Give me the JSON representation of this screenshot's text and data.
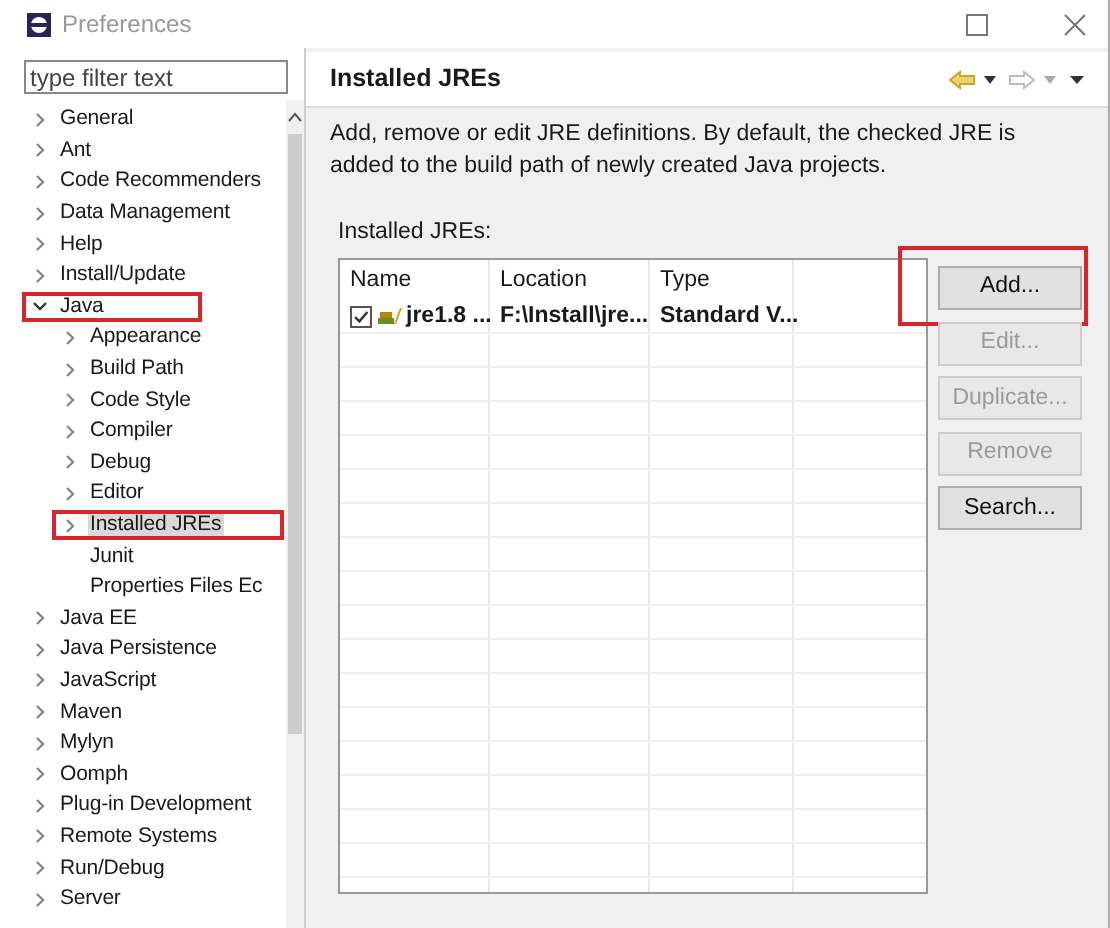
{
  "window": {
    "title": "Preferences"
  },
  "filter": {
    "placeholder": "type filter text"
  },
  "tree": [
    {
      "label": "General",
      "kind": "folder",
      "expanded": false,
      "selected": false,
      "highlighted": false
    },
    {
      "label": "Ant",
      "kind": "folder",
      "expanded": false,
      "selected": false,
      "highlighted": false
    },
    {
      "label": "Code Recommenders",
      "kind": "folder",
      "expanded": false,
      "selected": false,
      "highlighted": false
    },
    {
      "label": "Data Management",
      "kind": "folder",
      "expanded": false,
      "selected": false,
      "highlighted": false
    },
    {
      "label": "Help",
      "kind": "folder",
      "expanded": false,
      "selected": false,
      "highlighted": false
    },
    {
      "label": "Install/Update",
      "kind": "folder",
      "expanded": false,
      "selected": false,
      "highlighted": false
    },
    {
      "label": "Java",
      "kind": "folder",
      "expanded": true,
      "selected": false,
      "highlighted": true,
      "children": [
        {
          "label": "Appearance",
          "kind": "folder",
          "expanded": false,
          "selected": false,
          "highlighted": false
        },
        {
          "label": "Build Path",
          "kind": "folder",
          "expanded": false,
          "selected": false,
          "highlighted": false
        },
        {
          "label": "Code Style",
          "kind": "folder",
          "expanded": false,
          "selected": false,
          "highlighted": false
        },
        {
          "label": "Compiler",
          "kind": "folder",
          "expanded": false,
          "selected": false,
          "highlighted": false
        },
        {
          "label": "Debug",
          "kind": "folder",
          "expanded": false,
          "selected": false,
          "highlighted": false
        },
        {
          "label": "Editor",
          "kind": "folder",
          "expanded": false,
          "selected": false,
          "highlighted": false
        },
        {
          "label": "Installed JREs",
          "kind": "folder",
          "expanded": false,
          "selected": true,
          "highlighted": true
        },
        {
          "label": "Junit",
          "kind": "leaf",
          "selected": false,
          "highlighted": false
        },
        {
          "label": "Properties Files Ec",
          "kind": "leaf",
          "selected": false,
          "highlighted": false
        }
      ]
    },
    {
      "label": "Java EE",
      "kind": "folder",
      "expanded": false,
      "selected": false,
      "highlighted": false
    },
    {
      "label": "Java Persistence",
      "kind": "folder",
      "expanded": false,
      "selected": false,
      "highlighted": false
    },
    {
      "label": "JavaScript",
      "kind": "folder",
      "expanded": false,
      "selected": false,
      "highlighted": false
    },
    {
      "label": "Maven",
      "kind": "folder",
      "expanded": false,
      "selected": false,
      "highlighted": false
    },
    {
      "label": "Mylyn",
      "kind": "folder",
      "expanded": false,
      "selected": false,
      "highlighted": false
    },
    {
      "label": "Oomph",
      "kind": "folder",
      "expanded": false,
      "selected": false,
      "highlighted": false
    },
    {
      "label": "Plug-in Development",
      "kind": "folder",
      "expanded": false,
      "selected": false,
      "highlighted": false
    },
    {
      "label": "Remote Systems",
      "kind": "folder",
      "expanded": false,
      "selected": false,
      "highlighted": false
    },
    {
      "label": "Run/Debug",
      "kind": "folder",
      "expanded": false,
      "selected": false,
      "highlighted": false
    },
    {
      "label": "Server",
      "kind": "folder",
      "expanded": false,
      "selected": false,
      "highlighted": false
    }
  ],
  "page": {
    "title": "Installed JREs",
    "description": "Add, remove or edit JRE definitions. By default, the checked JRE is added to the build path of newly created Java projects.",
    "table_label": "Installed JREs:",
    "table": {
      "columns": [
        "Name",
        "Location",
        "Type"
      ],
      "rows": [
        {
          "checked": true,
          "name": "jre1.8 ...",
          "location": "F:\\Install\\jre...",
          "type": "Standard V..."
        }
      ]
    },
    "buttons": [
      {
        "label": "Add...",
        "disabled": false,
        "highlighted": true
      },
      {
        "label": "Edit...",
        "disabled": true,
        "highlighted": false
      },
      {
        "label": "Duplicate...",
        "disabled": true,
        "highlighted": false
      },
      {
        "label": "Remove",
        "disabled": true,
        "highlighted": false
      },
      {
        "label": "Search...",
        "disabled": false,
        "highlighted": false
      }
    ]
  }
}
